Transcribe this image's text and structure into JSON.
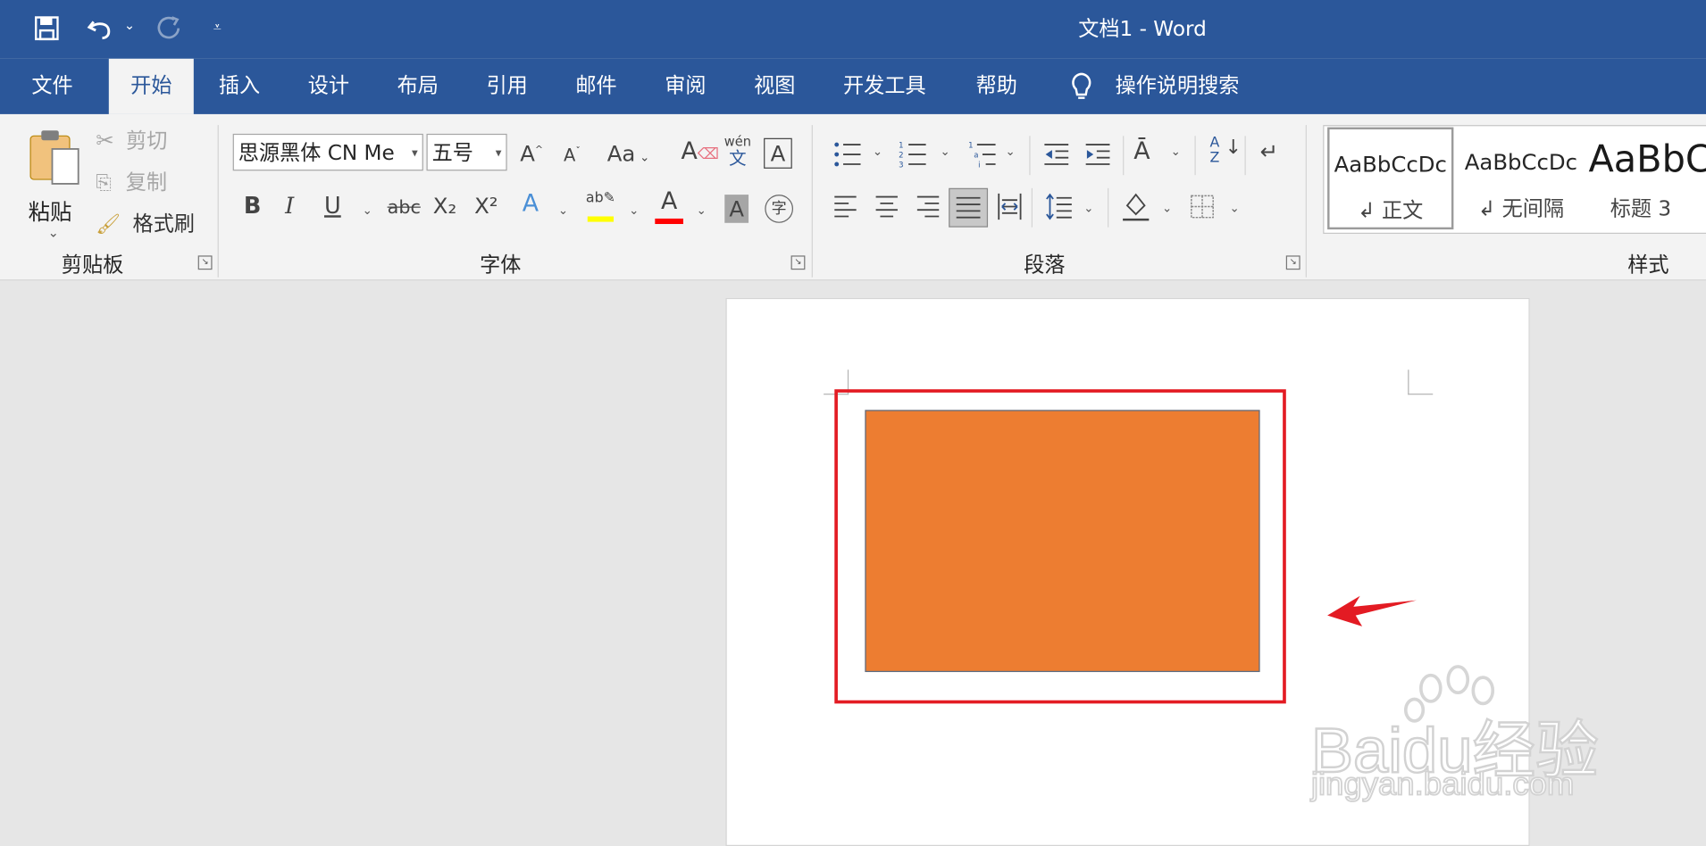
{
  "window": {
    "title": "文档1  -  Word"
  },
  "qat": {
    "save_icon": "save-icon",
    "undo_icon": "undo-icon",
    "redo_icon": "redo-icon",
    "customize_icon": "customize-qat-icon"
  },
  "tabs": [
    {
      "label": "文件"
    },
    {
      "label": "开始"
    },
    {
      "label": "插入"
    },
    {
      "label": "设计"
    },
    {
      "label": "布局"
    },
    {
      "label": "引用"
    },
    {
      "label": "邮件"
    },
    {
      "label": "审阅"
    },
    {
      "label": "视图"
    },
    {
      "label": "开发工具"
    },
    {
      "label": "帮助"
    }
  ],
  "active_tab": "开始",
  "search": {
    "label": "操作说明搜索",
    "icon": "lightbulb-icon"
  },
  "clipboard": {
    "group_label": "剪贴板",
    "paste_label": "粘贴",
    "cut_label": "剪切",
    "copy_label": "复制",
    "format_painter_label": "格式刷"
  },
  "font": {
    "group_label": "字体",
    "font_name": "思源黑体 CN Me",
    "font_size": "五号",
    "change_case": "Aa",
    "phonetic_top": "wén",
    "phonetic_bottom": "文",
    "bold": "B",
    "italic": "I",
    "underline": "U",
    "strike": "abc",
    "sub": "X₂",
    "sup": "X²",
    "highlight_color": "#ffff00",
    "font_color": "#ff0000",
    "char_border": "A",
    "enclose": "字"
  },
  "paragraph": {
    "group_label": "段落"
  },
  "styles": {
    "group_label": "样式",
    "items": [
      {
        "preview": "AaBbCcDc",
        "name": "↲ 正文"
      },
      {
        "preview": "AaBbCcDc",
        "name": "↲ 无间隔"
      },
      {
        "preview": "AaBbC",
        "name": "标题 3"
      }
    ]
  },
  "document": {
    "shape_fill": "#ed7d31",
    "annotation_color": "#e31b23"
  },
  "watermark": {
    "logo": "Baidu经验",
    "url": "jingyan.baidu.com"
  }
}
